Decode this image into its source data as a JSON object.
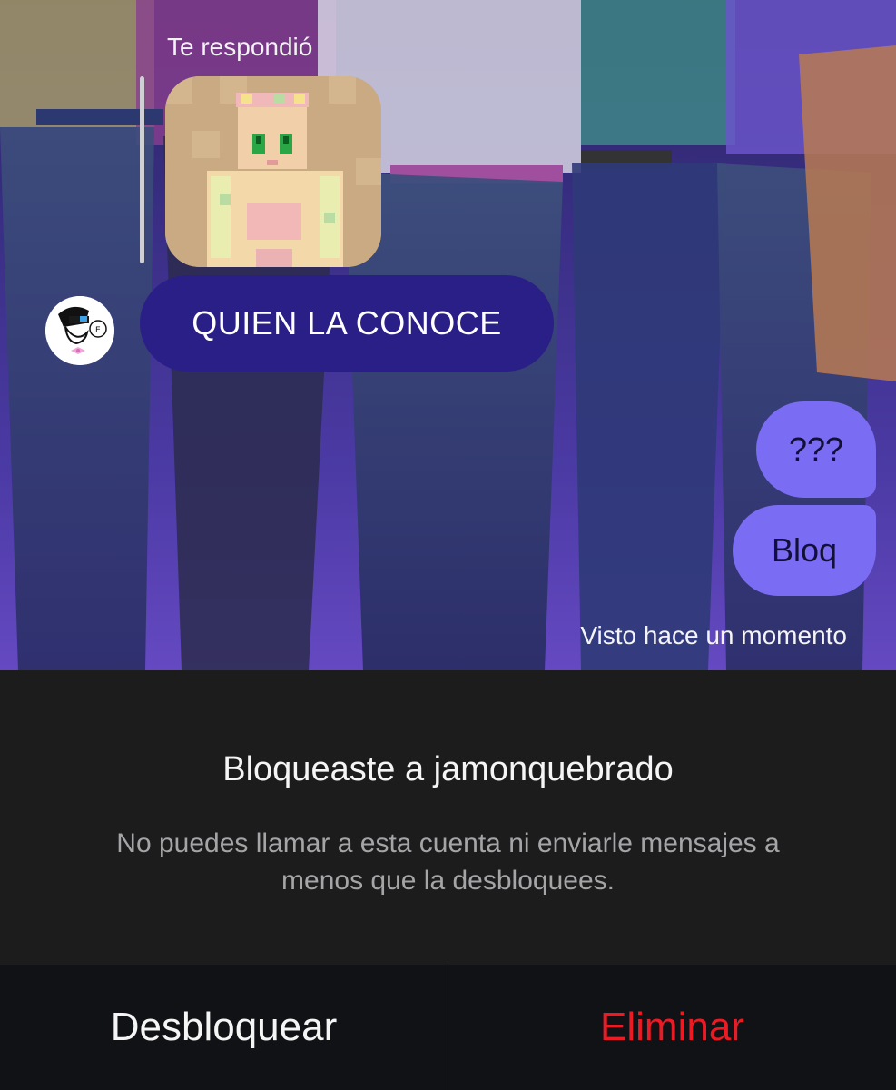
{
  "chat": {
    "reply_label": "Te respondió",
    "incoming_message": "QUIEN LA CONOCE",
    "outgoing_messages": [
      "???",
      "Bloq"
    ],
    "seen_status": "Visto hace un momento"
  },
  "block_panel": {
    "title": "Bloqueaste a jamonquebrado",
    "description": "No puedes llamar a esta cuenta ni enviarle mensajes a menos que la desbloquees."
  },
  "actions": {
    "unblock_label": "Desbloquear",
    "delete_label": "Eliminar"
  },
  "colors": {
    "incoming_bubble": "#2a1f86",
    "outgoing_bubble": "#7b6cf4",
    "delete_red": "#ea1b24"
  }
}
